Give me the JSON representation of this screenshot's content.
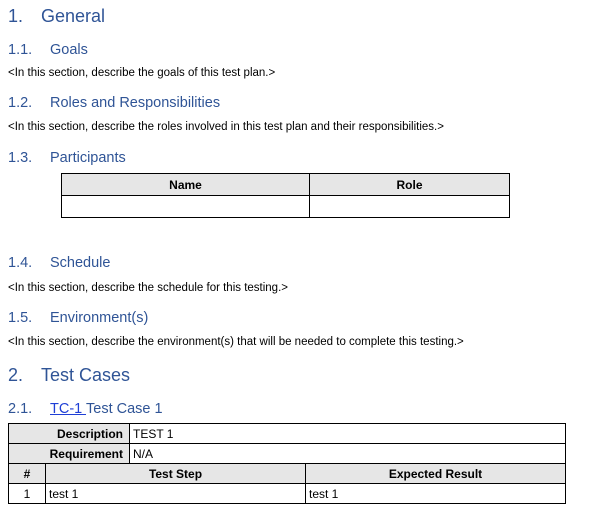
{
  "sections": {
    "general": {
      "num": "1.",
      "title": "General"
    },
    "goals": {
      "num": "1.1.",
      "title": "Goals",
      "body": "<In this section, describe the goals of this test plan.>"
    },
    "roles": {
      "num": "1.2.",
      "title": "Roles and Responsibilities",
      "body": "<In this section, describe the roles involved in this test plan and their responsibilities.>"
    },
    "participants": {
      "num": "1.3.",
      "title": "Participants",
      "table": {
        "headers": [
          "Name",
          "Role"
        ],
        "rows": [
          [
            "",
            ""
          ]
        ]
      }
    },
    "schedule": {
      "num": "1.4.",
      "title": "Schedule",
      "body": "<In this section, describe the schedule for this testing.>"
    },
    "environment": {
      "num": "1.5.",
      "title": "Environment(s)",
      "body": "<In this section, describe the environment(s) that will be needed to complete this testing.>"
    },
    "test_cases": {
      "num": "2.",
      "title": "Test Cases"
    },
    "tc1": {
      "num": "2.1.",
      "link": "TC-1 ",
      "title": "Test Case 1",
      "description_label": "Description",
      "description_value": "TEST 1",
      "requirement_label": "Requirement",
      "requirement_value": "N/A",
      "headers": [
        "#",
        "Test Step",
        "Expected Result"
      ],
      "rows": [
        [
          "1",
          "test 1",
          "test 1"
        ]
      ]
    }
  }
}
